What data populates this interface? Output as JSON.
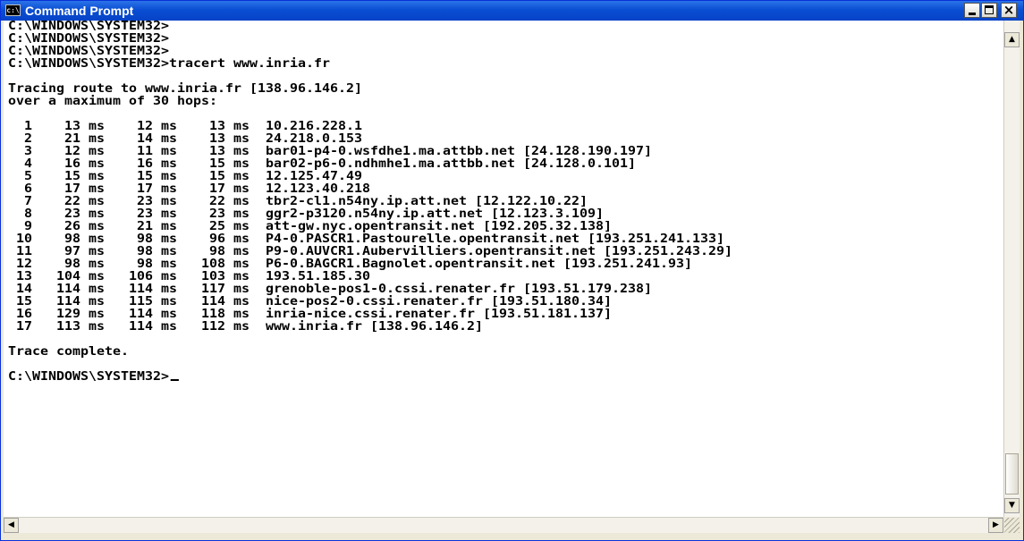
{
  "window": {
    "title": "Command Prompt",
    "icon_text": "c:\\",
    "icon": "console-icon"
  },
  "title_buttons": {
    "minimize": "minimize-icon",
    "maximize": "maximize-icon",
    "close": "close-icon",
    "close_glyph": "×"
  },
  "console": {
    "lines": [
      "C:\\WINDOWS\\SYSTEM32>",
      "C:\\WINDOWS\\SYSTEM32>",
      "C:\\WINDOWS\\SYSTEM32>",
      "C:\\WINDOWS\\SYSTEM32>tracert www.inria.fr",
      "",
      "Tracing route to www.inria.fr [138.96.146.2]",
      "over a maximum of 30 hops:",
      "",
      "  1    13 ms    12 ms    13 ms  10.216.228.1",
      "  2    21 ms    14 ms    13 ms  24.218.0.153",
      "  3    12 ms    11 ms    13 ms  bar01-p4-0.wsfdhe1.ma.attbb.net [24.128.190.197]",
      "  4    16 ms    16 ms    15 ms  bar02-p6-0.ndhmhe1.ma.attbb.net [24.128.0.101]",
      "  5    15 ms    15 ms    15 ms  12.125.47.49",
      "  6    17 ms    17 ms    17 ms  12.123.40.218",
      "  7    22 ms    23 ms    22 ms  tbr2-cl1.n54ny.ip.att.net [12.122.10.22]",
      "  8    23 ms    23 ms    23 ms  ggr2-p3120.n54ny.ip.att.net [12.123.3.109]",
      "  9    26 ms    21 ms    25 ms  att-gw.nyc.opentransit.net [192.205.32.138]",
      " 10    98 ms    98 ms    96 ms  P4-0.PASCR1.Pastourelle.opentransit.net [193.251.241.133]",
      " 11    97 ms    98 ms    98 ms  P9-0.AUVCR1.Aubervilliers.opentransit.net [193.251.243.29]",
      " 12    98 ms    98 ms   108 ms  P6-0.BAGCR1.Bagnolet.opentransit.net [193.251.241.93]",
      " 13   104 ms   106 ms   103 ms  193.51.185.30",
      " 14   114 ms   114 ms   117 ms  grenoble-pos1-0.cssi.renater.fr [193.51.179.238]",
      " 15   114 ms   115 ms   114 ms  nice-pos2-0.cssi.renater.fr [193.51.180.34]",
      " 16   129 ms   114 ms   118 ms  inria-nice.cssi.renater.fr [193.51.181.137]",
      " 17   113 ms   114 ms   112 ms  www.inria.fr [138.96.146.2]",
      "",
      "Trace complete.",
      "",
      "C:\\WINDOWS\\SYSTEM32>"
    ]
  },
  "scrollbars": {
    "up_glyph": "▲",
    "down_glyph": "▼",
    "left_glyph": "◀",
    "right_glyph": "▶"
  }
}
